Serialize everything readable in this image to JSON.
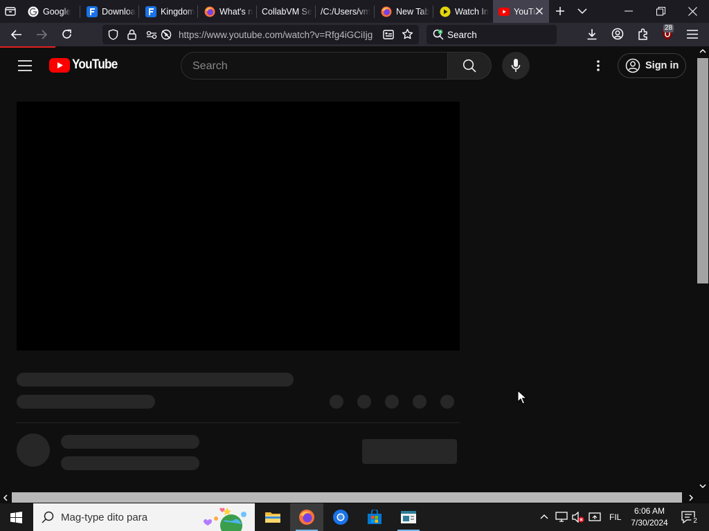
{
  "browser": {
    "tabs": [
      {
        "label": "Google",
        "icon": "google-icon"
      },
      {
        "label": "Downloa",
        "icon": "f-icon"
      },
      {
        "label": "Kingdom",
        "icon": "f-icon"
      },
      {
        "label": "What's n",
        "icon": "firefox-icon"
      },
      {
        "label": "CollabVM Se",
        "icon": "none"
      },
      {
        "label": "/C:/Users/vm",
        "icon": "none"
      },
      {
        "label": "New Tab",
        "icon": "firefox-icon"
      },
      {
        "label": "Watch In",
        "icon": "play-icon"
      },
      {
        "label": "YouTu",
        "icon": "youtube-icon",
        "active": true
      }
    ],
    "url": "https://www.youtube.com/watch?v=Rfg4iGCiIjg",
    "search_placeholder": "Search",
    "badge_count": "28"
  },
  "youtube": {
    "logo_text": "YouTube",
    "search_placeholder": "Search",
    "sign_in": "Sign in"
  },
  "taskbar": {
    "search_placeholder": "Mag-type dito para",
    "language": "FIL",
    "time": "6:06 AM",
    "date": "7/30/2024",
    "notification_count": "2"
  },
  "colors": {
    "youtube_red": "#ff0000",
    "page_bg": "#0f0f0f",
    "tab_strip": "#1c1b22",
    "toolbar": "#2b2a33",
    "skeleton": "#272727"
  }
}
